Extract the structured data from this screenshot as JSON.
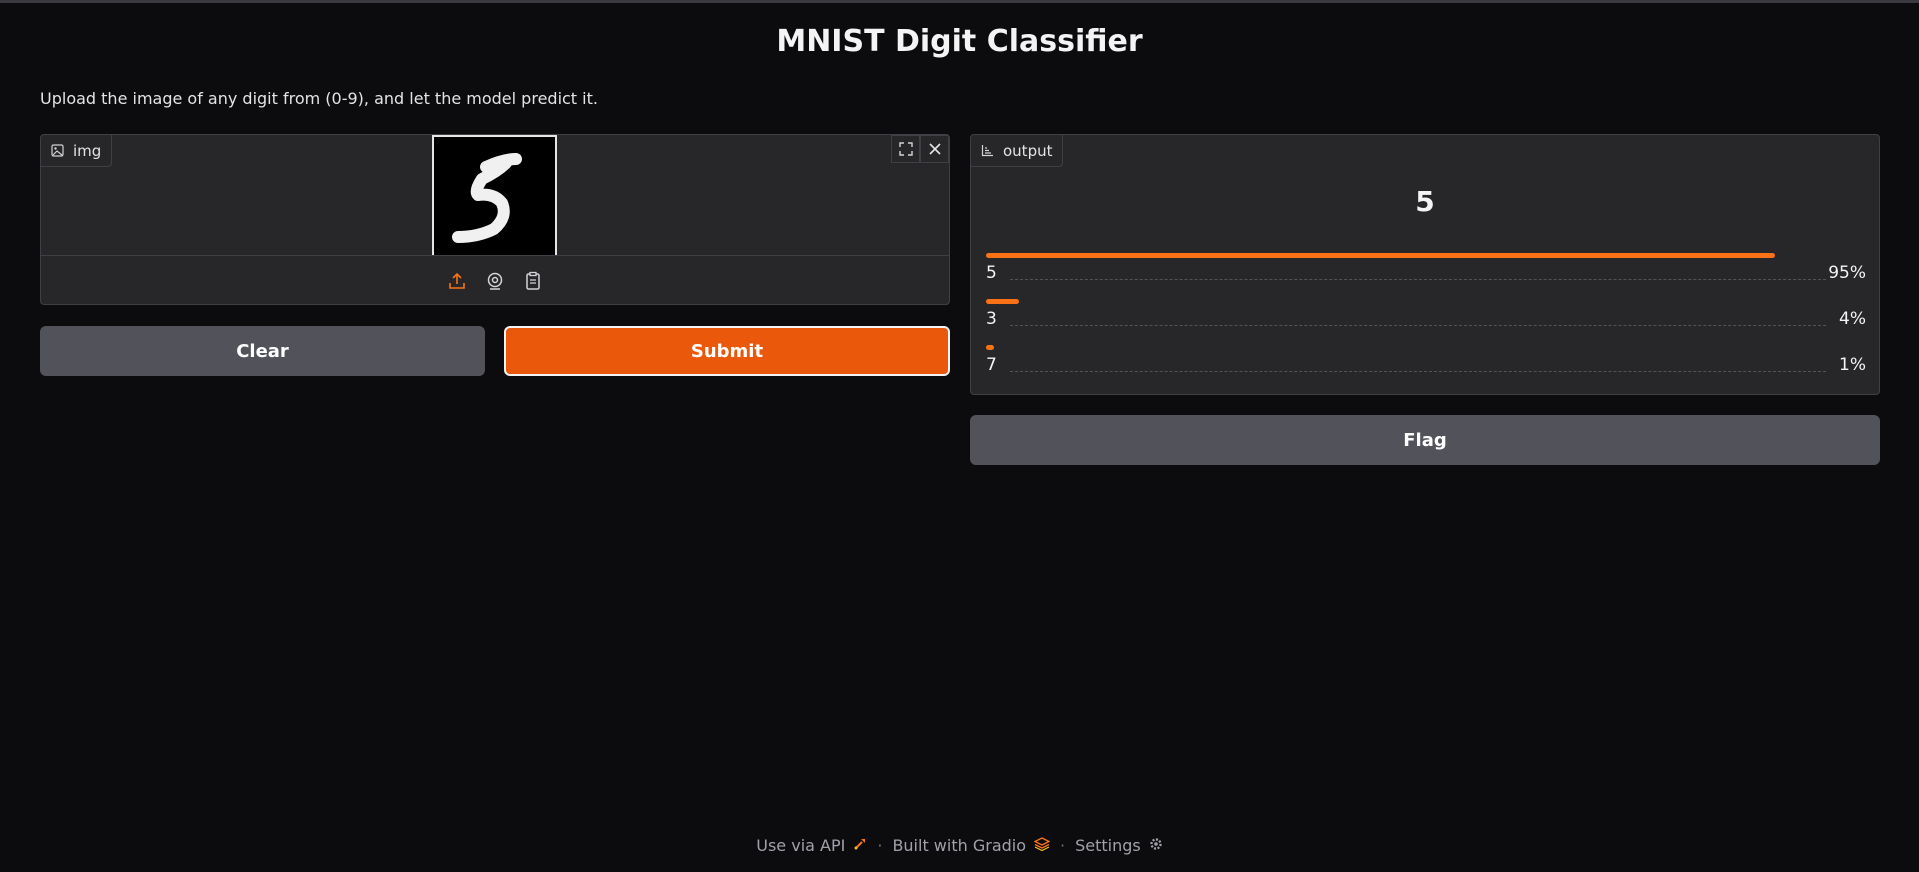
{
  "app": {
    "title": "MNIST Digit Classifier",
    "description": "Upload the image of any digit from (0-9), and let the model predict it."
  },
  "input": {
    "label": "img",
    "preview_digit": "5",
    "icons": [
      "image-icon",
      "fullscreen-icon",
      "close-icon",
      "upload-icon",
      "webcam-icon",
      "clipboard-icon"
    ]
  },
  "buttons": {
    "clear": "Clear",
    "submit": "Submit",
    "flag": "Flag"
  },
  "output": {
    "label": "output",
    "prediction": "5",
    "confidences": [
      {
        "label": "5",
        "percent": "95%",
        "value": 0.95
      },
      {
        "label": "3",
        "percent": "4%",
        "value": 0.04
      },
      {
        "label": "7",
        "percent": "1%",
        "value": 0.01
      }
    ]
  },
  "footer": {
    "api": "Use via API",
    "separator": "·",
    "built": "Built with Gradio",
    "settings": "Settings"
  },
  "colors": {
    "accent": "#ea580c",
    "bar": "#f97316",
    "secondary_button": "#52525b",
    "panel": "#27272a",
    "background": "#0c0c0f"
  }
}
